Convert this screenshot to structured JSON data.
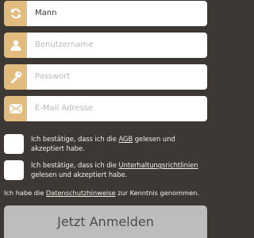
{
  "form": {
    "gender": {
      "value": "Mann",
      "icon": "refresh-icon"
    },
    "username": {
      "placeholder": "Benutzername",
      "icon": "user-icon"
    },
    "password": {
      "placeholder": "Passwort",
      "icon": "key-icon"
    },
    "email": {
      "placeholder": "E-Mail Adresse",
      "icon": "envelope-icon"
    }
  },
  "consents": {
    "agb": {
      "text_before": "Ich bestätige, dass ich die ",
      "link": "AGB",
      "text_after": " gelesen und akzeptiert habe.",
      "checked": false
    },
    "terms": {
      "text_before": "Ich bestätige, dass ich die ",
      "link": "Unterhaltungsrichtlinien",
      "text_after": " gelesen und akzeptiert habe.",
      "checked": false
    },
    "privacy": {
      "text_before": "Ich habe die ",
      "link": "Datenschutzhinweise",
      "text_after": " zur Kenntnis genommen."
    }
  },
  "submit": {
    "label": "Jetzt Anmelden"
  },
  "colors": {
    "background": "#3d3833",
    "icon_bg": "#e2bc7e",
    "button_bg": "#bdbdbd"
  }
}
